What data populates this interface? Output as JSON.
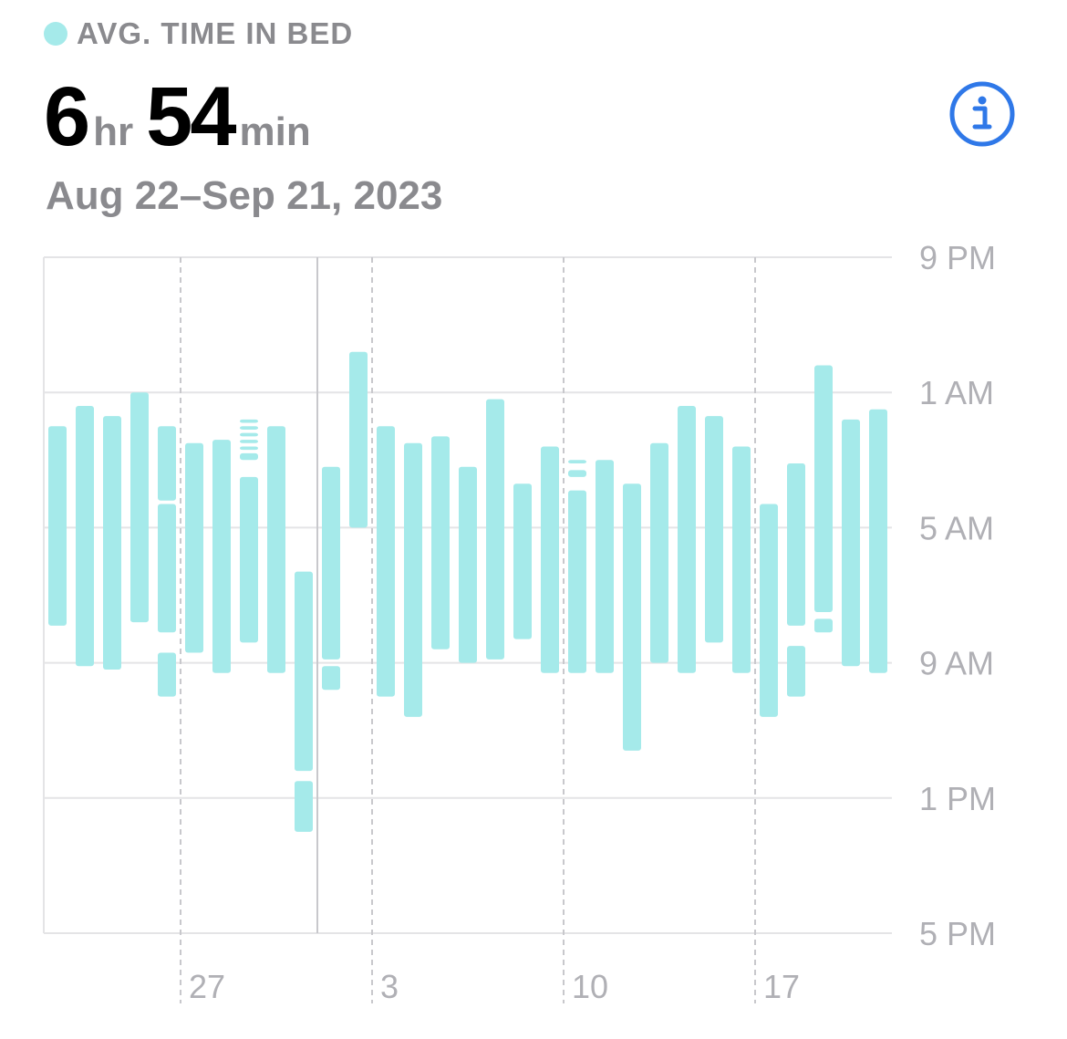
{
  "header": {
    "legend_label": "AVG. TIME IN BED",
    "hours_value": "6",
    "hours_unit": "hr",
    "minutes_value": "54",
    "minutes_unit": "min",
    "date_range": "Aug 22–Sep 21, 2023",
    "info_icon": "info-circle-icon"
  },
  "colors": {
    "bar": "#a5eaea",
    "accent": "#2f78e8",
    "label": "#8a8a8e",
    "tick": "#b0b0b5",
    "grid": "#e4e4e6"
  },
  "chart_data": {
    "type": "bar",
    "orientation": "vertical-range",
    "title": "AVG. TIME IN BED",
    "y_axis": {
      "ticks": [
        "9 PM",
        "1 AM",
        "5 AM",
        "9 AM",
        "1 PM",
        "5 PM"
      ],
      "range_hours_after_9pm": [
        0,
        20
      ],
      "inverted": true,
      "position": "right"
    },
    "x_axis": {
      "start": "Aug 22",
      "end": "Sep 21",
      "tick_labels": [
        {
          "label": "27",
          "day_index": 5
        },
        {
          "label": "3",
          "day_index": 12
        },
        {
          "label": "10",
          "day_index": 19
        },
        {
          "label": "17",
          "day_index": 26
        }
      ]
    },
    "week_boundary_day_index": 10,
    "series": [
      {
        "unit": "hours after 9 PM",
        "days": [
          {
            "day": "Aug 22",
            "segments": [
              [
                5.0,
                10.9
              ]
            ]
          },
          {
            "day": "Aug 23",
            "segments": [
              [
                4.4,
                12.1
              ]
            ]
          },
          {
            "day": "Aug 24",
            "segments": [
              [
                4.7,
                12.2
              ]
            ]
          },
          {
            "day": "Aug 25",
            "segments": [
              [
                4.0,
                10.8
              ]
            ]
          },
          {
            "day": "Aug 26",
            "segments": [
              [
                5.0,
                7.2
              ],
              [
                7.3,
                11.1
              ],
              [
                11.7,
                13.0
              ]
            ]
          },
          {
            "day": "Aug 27",
            "segments": [
              [
                5.5,
                11.7
              ]
            ]
          },
          {
            "day": "Aug 28",
            "segments": [
              [
                5.4,
                12.3
              ]
            ]
          },
          {
            "day": "Aug 29",
            "segments": [
              [
                4.8,
                4.9
              ],
              [
                5.0,
                5.1
              ],
              [
                5.2,
                5.3
              ],
              [
                5.4,
                5.5
              ],
              [
                5.6,
                5.7
              ],
              [
                5.8,
                6.0
              ],
              [
                6.5,
                11.4
              ]
            ]
          },
          {
            "day": "Aug 30",
            "segments": [
              [
                5.0,
                12.3
              ]
            ]
          },
          {
            "day": "Aug 31",
            "segments": [
              [
                9.3,
                15.2
              ],
              [
                15.5,
                17.0
              ]
            ]
          },
          {
            "day": "Sep 1",
            "segments": [
              [
                6.2,
                11.9
              ],
              [
                12.1,
                12.8
              ]
            ]
          },
          {
            "day": "Sep 2",
            "segments": [
              [
                2.8,
                8.0
              ]
            ]
          },
          {
            "day": "Sep 3",
            "segments": [
              [
                5.0,
                13.0
              ]
            ]
          },
          {
            "day": "Sep 4",
            "segments": [
              [
                5.5,
                13.6
              ]
            ]
          },
          {
            "day": "Sep 5",
            "segments": [
              [
                5.3,
                11.6
              ]
            ]
          },
          {
            "day": "Sep 6",
            "segments": [
              [
                6.2,
                12.0
              ]
            ]
          },
          {
            "day": "Sep 7",
            "segments": [
              [
                4.2,
                11.9
              ]
            ]
          },
          {
            "day": "Sep 8",
            "segments": [
              [
                6.7,
                11.3
              ]
            ]
          },
          {
            "day": "Sep 9",
            "segments": [
              [
                5.6,
                12.3
              ]
            ]
          },
          {
            "day": "Sep 10",
            "segments": [
              [
                6.0,
                6.1
              ],
              [
                6.3,
                6.5
              ],
              [
                6.9,
                12.3
              ]
            ]
          },
          {
            "day": "Sep 11",
            "segments": [
              [
                6.0,
                12.3
              ]
            ]
          },
          {
            "day": "Sep 12",
            "segments": [
              [
                6.7,
                14.6
              ]
            ]
          },
          {
            "day": "Sep 13",
            "segments": [
              [
                5.5,
                12.0
              ]
            ]
          },
          {
            "day": "Sep 14",
            "segments": [
              [
                4.4,
                12.3
              ]
            ]
          },
          {
            "day": "Sep 15",
            "segments": [
              [
                4.7,
                11.4
              ]
            ]
          },
          {
            "day": "Sep 16",
            "segments": [
              [
                5.6,
                12.3
              ]
            ]
          },
          {
            "day": "Sep 17",
            "segments": [
              [
                7.3,
                13.6
              ]
            ]
          },
          {
            "day": "Sep 18",
            "segments": [
              [
                6.1,
                10.9
              ],
              [
                11.5,
                13.0
              ]
            ]
          },
          {
            "day": "Sep 19",
            "segments": [
              [
                3.2,
                10.5
              ],
              [
                10.7,
                11.1
              ]
            ]
          },
          {
            "day": "Sep 20",
            "segments": [
              [
                4.8,
                12.1
              ]
            ]
          },
          {
            "day": "Sep 21",
            "segments": [
              [
                4.5,
                12.3
              ]
            ]
          }
        ]
      }
    ],
    "grid": true
  }
}
